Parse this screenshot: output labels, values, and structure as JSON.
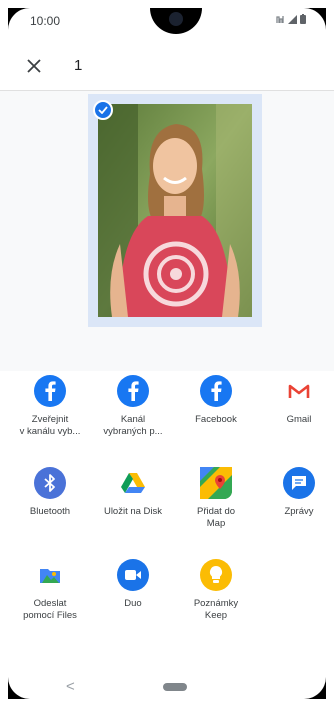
{
  "status_bar": {
    "time": "10:00"
  },
  "top_bar": {
    "selected_count": "1"
  },
  "apps": [
    {
      "label": "Zveřejnit\nv kanálu vyb...",
      "icon": "facebook-icon",
      "color": "#1877f2"
    },
    {
      "label": "Kanál\nvybraných p...",
      "icon": "facebook-icon",
      "color": "#1877f2"
    },
    {
      "label": "Facebook",
      "icon": "facebook-icon",
      "color": "#1877f2"
    },
    {
      "label": "Gmail",
      "icon": "gmail-icon",
      "color": "#ea4335"
    },
    {
      "label": "Bluetooth",
      "icon": "bluetooth-icon",
      "color": "#4a72d8"
    },
    {
      "label": "Uložit na Disk",
      "icon": "google-drive-icon",
      "color": "#fbbc04"
    },
    {
      "label": "Přidat do\nMap",
      "icon": "google-maps-icon",
      "color": "#34a853"
    },
    {
      "label": "Zprávy",
      "icon": "messages-icon",
      "color": "#1a73e8"
    },
    {
      "label": "Odeslat\npomocí Files",
      "icon": "files-icon",
      "color": "#4285f4"
    },
    {
      "label": "Duo",
      "icon": "duo-icon",
      "color": "#1a73e8"
    },
    {
      "label": "Poznámky\nKeep",
      "icon": "keep-icon",
      "color": "#fbbc04"
    }
  ],
  "nav_bar": {
    "back_glyph": "<"
  }
}
